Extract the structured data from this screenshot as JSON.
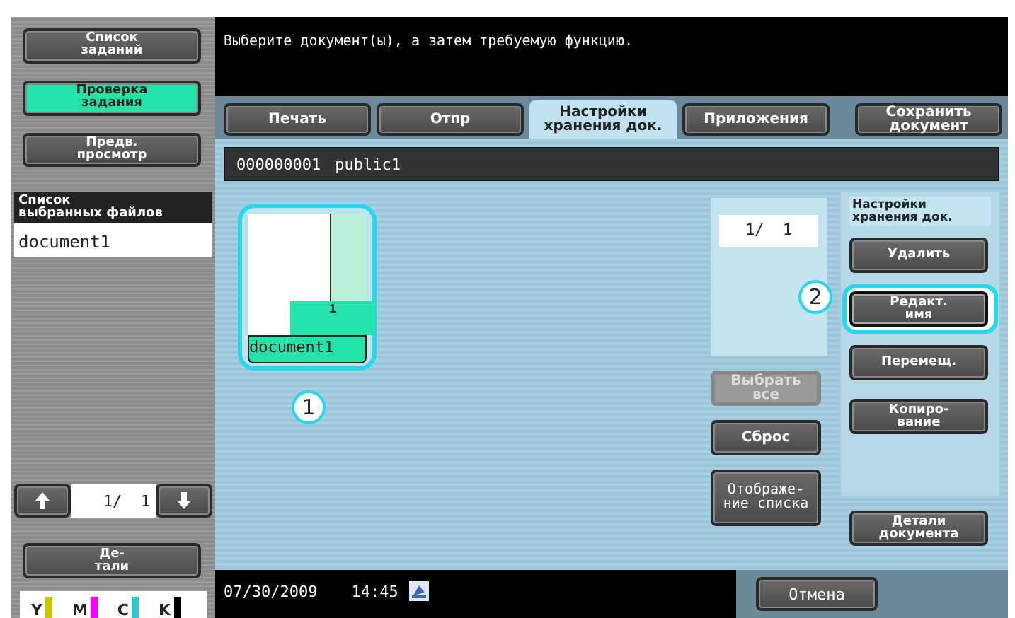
{
  "sidebar": {
    "buttons": [
      {
        "label": "Список\nзаданий",
        "selected": false
      },
      {
        "label": "Проверка\nзадания",
        "selected": true
      },
      {
        "label": "Предв.\nпросмотр",
        "selected": false
      }
    ]
  },
  "selected_files": {
    "title": "Список\nвыбранных файлов",
    "items": [
      {
        "label": "document1"
      }
    ]
  },
  "pager": {
    "text": "1/  1"
  },
  "details_button": "Де-\nтали",
  "toner": [
    {
      "label": "Y",
      "color": "#c8c800"
    },
    {
      "label": "M",
      "color": "#ff00ff"
    },
    {
      "label": "C",
      "color": "#30c8d0"
    },
    {
      "label": "K",
      "color": "#000000"
    }
  ],
  "message": "Выберите документ(ы), а затем требуемую функцию.",
  "tabs": [
    {
      "label": "Печать",
      "selected": false
    },
    {
      "label": "Отпр",
      "selected": false
    },
    {
      "label": "Настройки\nхранения док.",
      "selected": true
    },
    {
      "label": "Приложения",
      "selected": false
    }
  ],
  "save_button": "Сохранить\nдокумент",
  "document_bar": {
    "number": "000000001",
    "name": "public1"
  },
  "thumbnails": [
    {
      "name": "document1",
      "pages": "1",
      "selected": true,
      "callout": "1"
    }
  ],
  "page_counter": "1/  1",
  "list_buttons": [
    {
      "label": "Выбрать\nвсе",
      "disabled": true
    },
    {
      "label": "Сброс",
      "disabled": false
    },
    {
      "label": "Отображе-\nние списка",
      "disabled": false
    }
  ],
  "settings_panel": {
    "title": "Настройки\nхранения док.",
    "buttons": [
      {
        "label": "Удалить",
        "highlighted": false
      },
      {
        "label": "Редакт.\nимя",
        "highlighted": true,
        "callout": "2"
      },
      {
        "label": "Перемещ.",
        "highlighted": false
      },
      {
        "label": "Копиро-\nвание",
        "highlighted": false
      }
    ]
  },
  "document_details_button": "Детали\nдокумента",
  "status": {
    "date": "07/30/2009",
    "time": "14:45"
  },
  "cancel_button": "Отмена"
}
